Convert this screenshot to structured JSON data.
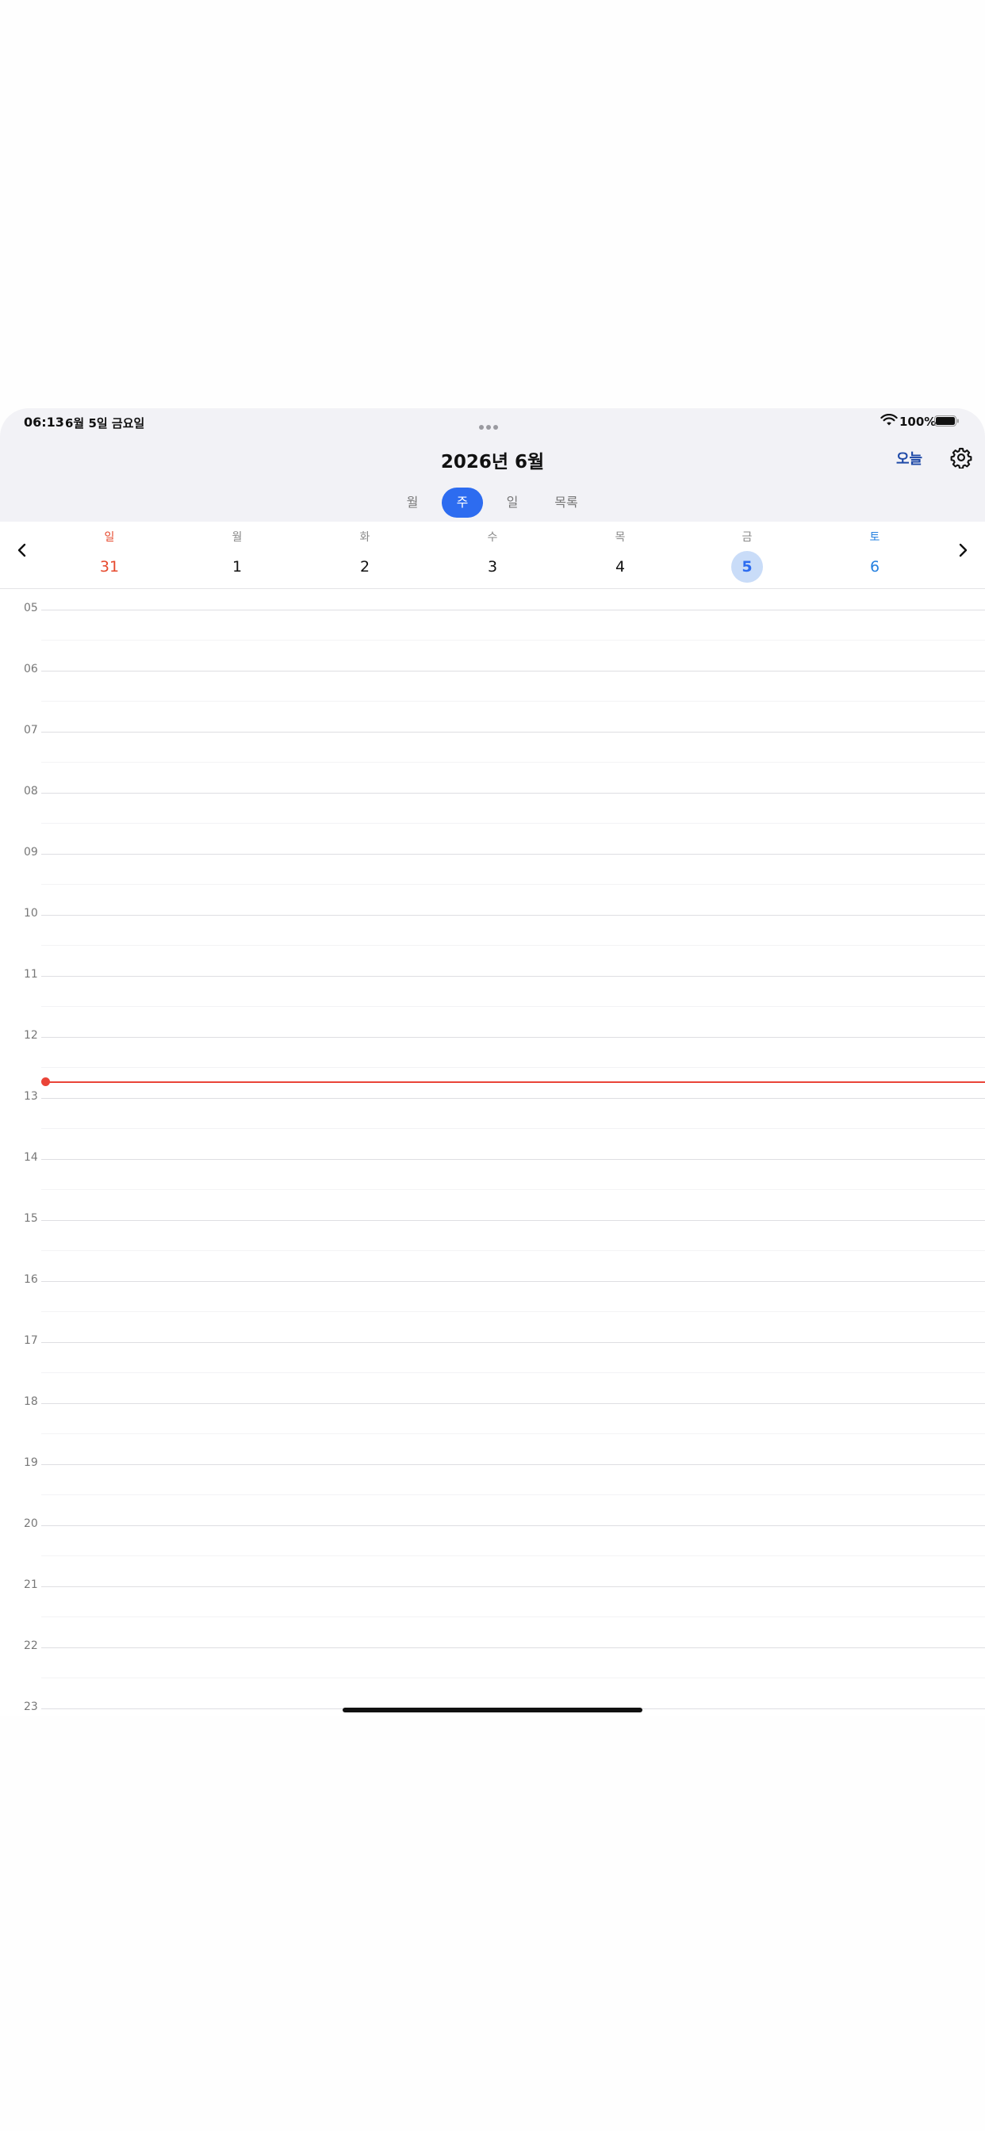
{
  "status_bar": {
    "time": "06:13",
    "date": "6월 5일 금요일",
    "battery": "100%",
    "wifi_icon": "wifi-icon",
    "battery_icon": "battery-full-icon"
  },
  "header": {
    "title": "2026년 6월",
    "today_label": "오늘",
    "settings_icon": "gear-icon"
  },
  "view_tabs": [
    {
      "label": "월",
      "active": false
    },
    {
      "label": "주",
      "active": true
    },
    {
      "label": "일",
      "active": false
    },
    {
      "label": "목록",
      "active": false
    }
  ],
  "week": {
    "prev_icon": "chevron-left-icon",
    "next_icon": "chevron-right-icon",
    "days": [
      {
        "name": "일",
        "num": "31"
      },
      {
        "name": "월",
        "num": "1"
      },
      {
        "name": "화",
        "num": "2"
      },
      {
        "name": "수",
        "num": "3"
      },
      {
        "name": "목",
        "num": "4"
      },
      {
        "name": "금",
        "num": "5",
        "selected": true
      },
      {
        "name": "토",
        "num": "6"
      }
    ]
  },
  "hours": [
    "05",
    "06",
    "07",
    "08",
    "09",
    "10",
    "11",
    "12",
    "13",
    "14",
    "15",
    "16",
    "17",
    "18",
    "19",
    "20",
    "21",
    "22",
    "23"
  ],
  "colors": {
    "accent": "#2d6cf0",
    "selected_day_bg": "#c9dcf8",
    "sunday": "#e6492d",
    "saturday": "#2580e0",
    "now_line": "#ea4438",
    "header_bg": "#f2f2f6"
  }
}
